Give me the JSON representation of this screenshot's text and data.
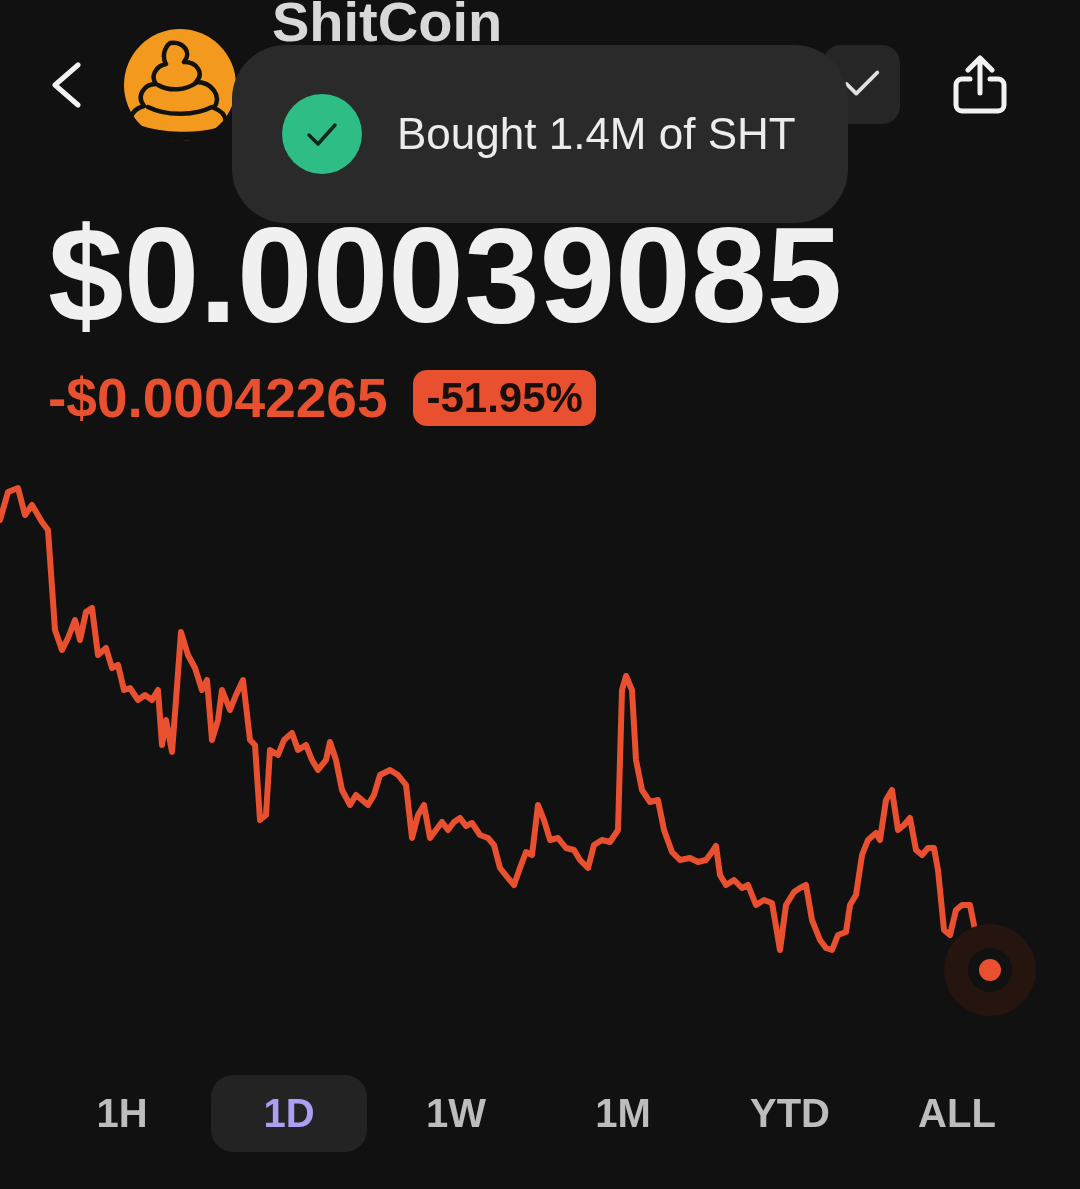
{
  "header": {
    "title": "ShitCoin",
    "watchlist": {
      "added": true
    }
  },
  "toast": {
    "message": "Bought 1.4M of SHT"
  },
  "price": {
    "value": "$0.00039085",
    "change": "-$0.00042265",
    "change_percent": "-51.95%"
  },
  "ranges": [
    {
      "label": "1H",
      "selected": false
    },
    {
      "label": "1D",
      "selected": true
    },
    {
      "label": "1W",
      "selected": false
    },
    {
      "label": "1M",
      "selected": false
    },
    {
      "label": "YTD",
      "selected": false
    },
    {
      "label": "ALL",
      "selected": false
    }
  ]
}
